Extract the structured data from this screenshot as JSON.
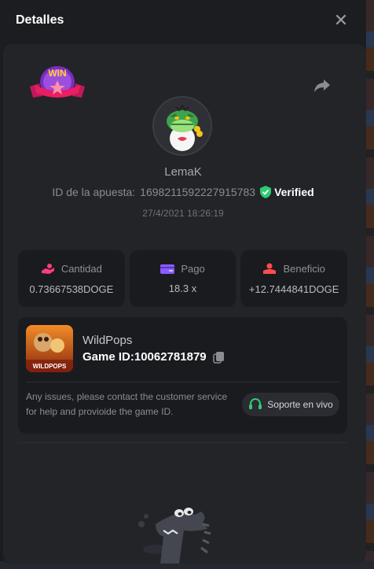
{
  "dialog": {
    "title": "Detalles"
  },
  "badge": {
    "text": "WIN"
  },
  "player": {
    "username": "LemaK",
    "bet_id_label": "ID de la apuesta:",
    "bet_id": "1698211592227915783",
    "verified_label": "Verified",
    "timestamp": "27/4/2021 18:26:19"
  },
  "stats": [
    {
      "label": "Cantidad",
      "value": "0.73667538DOGE",
      "icon": "coins-hand-icon"
    },
    {
      "label": "Pago",
      "value": "18.3 x",
      "icon": "wallet-icon"
    },
    {
      "label": "Beneficio",
      "value": "+12.7444841DOGE",
      "icon": "profit-hand-icon"
    }
  ],
  "game": {
    "name": "WildPops",
    "game_id_label": "Game ID:",
    "game_id": "10062781879",
    "thumb_text": "WILDPOPS",
    "support_text": "Any issues, please contact the customer service for help and provioide the game ID.",
    "support_button": "Soporte en vivo"
  },
  "colors": {
    "verified_green": "#2ecc71",
    "stat_icon_pink": "#ff3f7a",
    "stat_icon_purple": "#8a5cff",
    "stat_icon_red": "#ff4d4d",
    "support_green": "#2ecc71"
  }
}
